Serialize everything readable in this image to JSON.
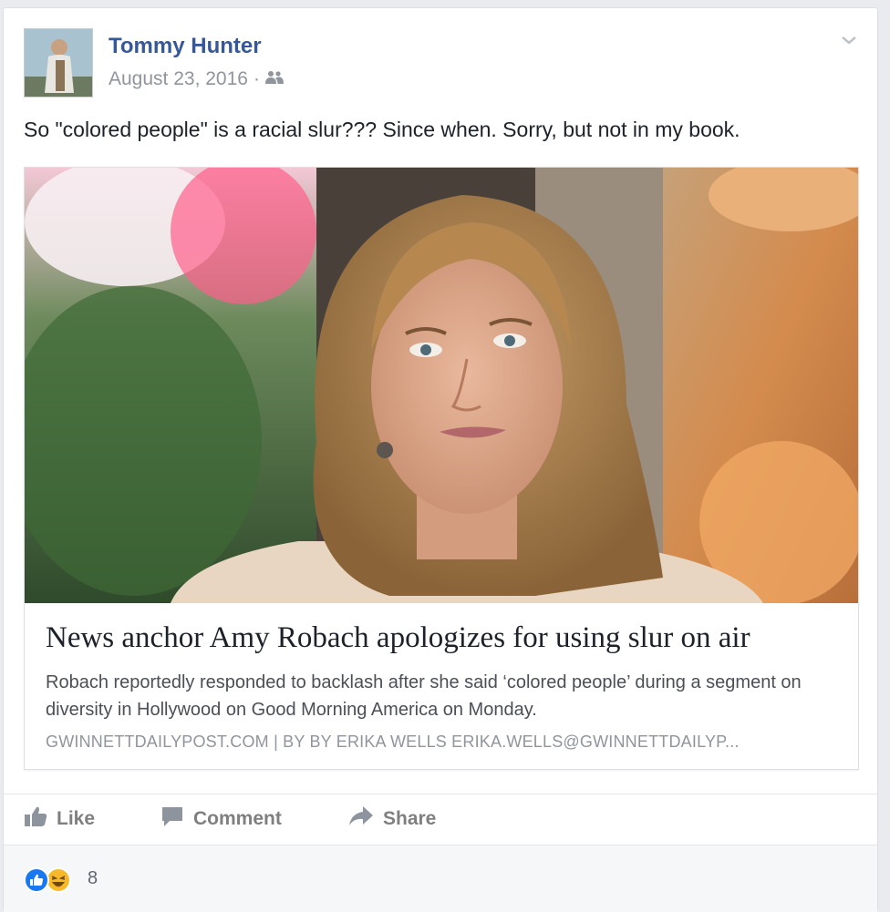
{
  "post": {
    "author": "Tommy Hunter",
    "date": "August 23, 2016",
    "separator": "·",
    "audience_icon": "friends-icon",
    "text": "So \"colored people\" is a racial slur??? Since when. Sorry, but not in my book."
  },
  "link_preview": {
    "title": "News anchor Amy Robach apologizes for using slur on air",
    "description": "Robach reportedly responded to backlash after she said ‘colored people’ during a segment on diversity in Hollywood on Good Morning America on Monday.",
    "source": "GWINNETTDAILYPOST.COM | BY BY ERIKA WELLS ERIKA.WELLS@GWINNETTDAILYP..."
  },
  "actions": {
    "like_label": "Like",
    "comment_label": "Comment",
    "share_label": "Share"
  },
  "reactions": {
    "count": "8",
    "types": [
      "like-reaction-icon",
      "haha-reaction-icon"
    ]
  },
  "colors": {
    "link_blue": "#365899",
    "like_blue": "#1877f2",
    "haha_yellow": "#f7b928",
    "grey_text": "#90949c"
  }
}
